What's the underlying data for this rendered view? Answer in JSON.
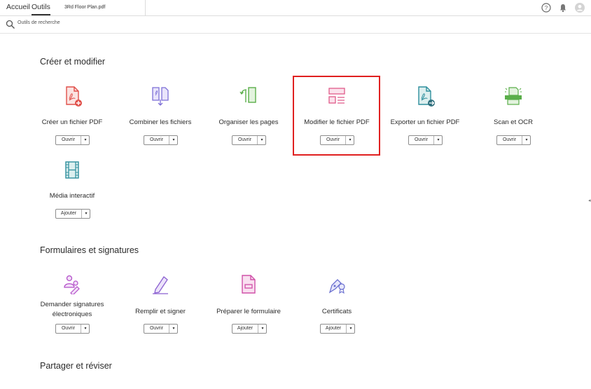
{
  "header": {
    "tabs": [
      {
        "label": "Accueil",
        "active": false
      },
      {
        "label": "Outils",
        "active": true
      }
    ],
    "document_tab": "3Rd Floor Plan.pdf",
    "icons": [
      "help-icon",
      "bell-icon",
      "user-icon"
    ]
  },
  "search": {
    "placeholder": "Outils de recherche",
    "icon": "search-icon"
  },
  "sections": [
    {
      "title": "Créer et modifier",
      "tools": [
        {
          "label": "Créer un fichier PDF",
          "button": "Ouvrir",
          "icon": "create-pdf-icon",
          "color": "#e0504a"
        },
        {
          "label": "Combiner les fichiers",
          "button": "Ouvrir",
          "icon": "combine-files-icon",
          "color": "#7d6fd6"
        },
        {
          "label": "Organiser les pages",
          "button": "Ouvrir",
          "icon": "organize-pages-icon",
          "color": "#5aae4a"
        },
        {
          "label": "Modifier le fichier PDF",
          "button": "Ouvrir",
          "icon": "edit-pdf-icon",
          "color": "#e05a8a",
          "highlighted": true
        },
        {
          "label": "Exporter un fichier PDF",
          "button": "Ouvrir",
          "icon": "export-pdf-icon",
          "color": "#2f8f9d"
        },
        {
          "label": "Scan et OCR",
          "button": "Ouvrir",
          "icon": "scan-ocr-icon",
          "color": "#5aae4a"
        },
        {
          "label": "Média interactif",
          "button": "Ajouter",
          "icon": "rich-media-icon",
          "color": "#2f8f9d"
        }
      ]
    },
    {
      "title": "Formulaires et signatures",
      "tools": [
        {
          "label": "Demander signatures électroniques",
          "button": "Ouvrir",
          "icon": "request-signatures-icon",
          "color": "#b34fc9"
        },
        {
          "label": "Remplir et signer",
          "button": "Ouvrir",
          "icon": "fill-sign-icon",
          "color": "#8a5fd0"
        },
        {
          "label": "Préparer le formulaire",
          "button": "Ajouter",
          "icon": "prepare-form-icon",
          "color": "#d050a8"
        },
        {
          "label": "Certificats",
          "button": "Ajouter",
          "icon": "certificates-icon",
          "color": "#6a6fd0"
        }
      ]
    },
    {
      "title": "Partager et réviser",
      "tools": []
    }
  ]
}
